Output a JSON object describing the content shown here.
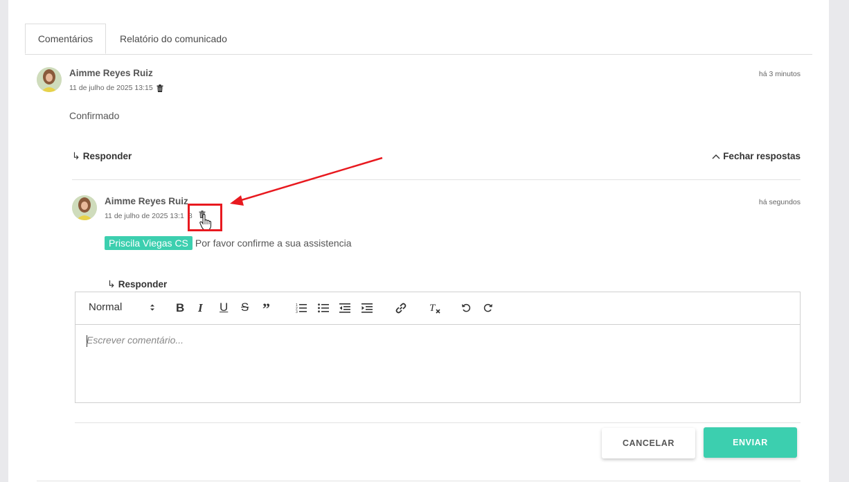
{
  "tabs": [
    {
      "label": "Comentários",
      "active": true
    },
    {
      "label": "Relatório do comunicado",
      "active": false
    }
  ],
  "comment": {
    "author": "Aimme Reyes Ruiz",
    "date": "11 de julho de 2025 13:15",
    "ago": "há 3 minutos",
    "text": "Confirmado",
    "reply_label": "Responder",
    "close_replies_label": "Fechar respostas"
  },
  "reply": {
    "author": "Aimme Reyes Ruiz",
    "date": "11 de julho de 2025 13:1",
    "date_tail": "8",
    "ago": "há segundos",
    "mention": "Priscila Viegas CS",
    "text": "Por favor confirme a sua assistencia",
    "reply_label": "Responder"
  },
  "editor": {
    "format_select": "Normal",
    "placeholder": "Escrever comentário..."
  },
  "buttons": {
    "cancel": "CANCELAR",
    "send": "ENVIAR"
  },
  "colors": {
    "accent": "#3ccfaf",
    "annotation_red": "#e8191f"
  }
}
